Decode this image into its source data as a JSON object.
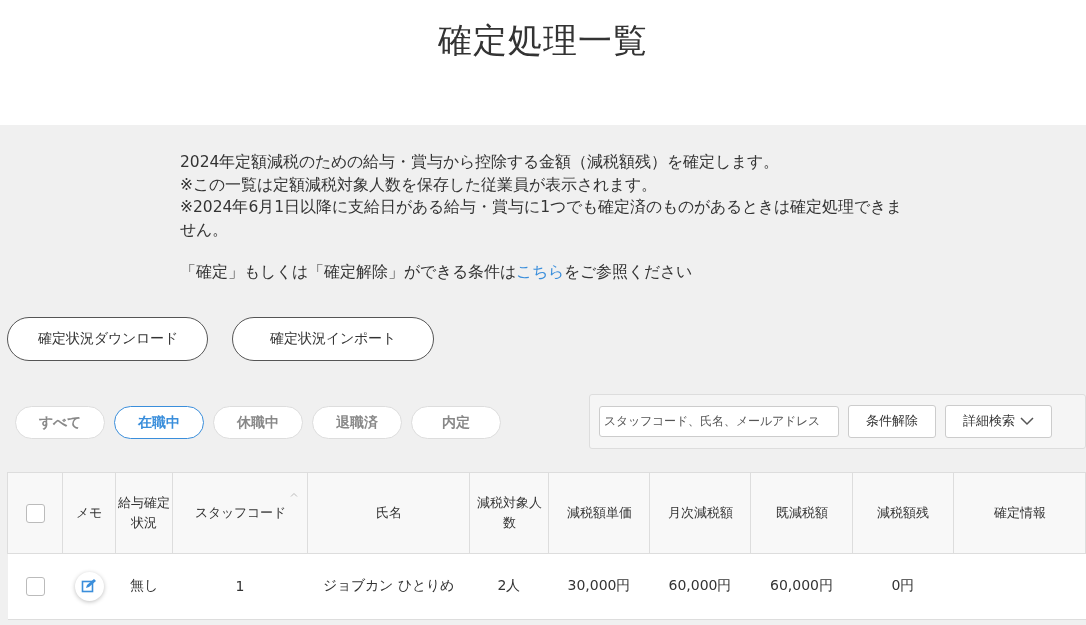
{
  "page_title": "確定処理一覧",
  "notes": [
    "2024年定額減税のための給与・賞与から控除する金額（減税額残）を確定します。",
    "※この一覧は定額減税対象人数を保存した従業員が表示されます。",
    "※2024年6月1日以降に支給日がある給与・賞与に1つでも確定済のものがあるときは確定処理できません。"
  ],
  "conditions_note": {
    "before": "「確定」もしくは「確定解除」ができる条件は",
    "link": "こちら",
    "after": "をご参照ください"
  },
  "action_buttons": [
    "確定状況ダウンロード",
    "確定状況インポート"
  ],
  "filter_tabs": [
    {
      "label": "すべて",
      "selected": false
    },
    {
      "label": "在職中",
      "selected": true
    },
    {
      "label": "休職中",
      "selected": false
    },
    {
      "label": "退職済",
      "selected": false
    },
    {
      "label": "内定",
      "selected": false
    }
  ],
  "search": {
    "placeholder": "スタッフコード、氏名、メールアドレス",
    "clear_button": "条件解除",
    "advanced_button": "詳細検索"
  },
  "table": {
    "columns": [
      {
        "kind": "select",
        "checked": false
      },
      {
        "kind": "text",
        "label": "メモ"
      },
      {
        "kind": "text",
        "label": "給与確定状況"
      },
      {
        "kind": "text",
        "label": "スタッフコード",
        "sortable": true
      },
      {
        "kind": "text",
        "label": "氏名"
      },
      {
        "kind": "text",
        "label": "減税対象人数"
      },
      {
        "kind": "text",
        "label": "減税額単価"
      },
      {
        "kind": "text",
        "label": "月次減税額"
      },
      {
        "kind": "text",
        "label": "既減税額"
      },
      {
        "kind": "text",
        "label": "減税額残"
      },
      {
        "kind": "text",
        "label": "確定情報"
      }
    ],
    "rows": [
      {
        "cells": [
          {
            "kind": "checkbox",
            "checked": false
          },
          {
            "kind": "memo"
          },
          {
            "kind": "text",
            "text": "無し"
          },
          {
            "kind": "text",
            "text": "1"
          },
          {
            "kind": "text",
            "text": "ジョブカン ひとりめ"
          },
          {
            "kind": "text",
            "text": "2人"
          },
          {
            "kind": "text",
            "text": "30,000円"
          },
          {
            "kind": "text",
            "text": "60,000円"
          },
          {
            "kind": "text",
            "text": "60,000円"
          },
          {
            "kind": "text",
            "text": "0円"
          }
        ]
      }
    ]
  }
}
